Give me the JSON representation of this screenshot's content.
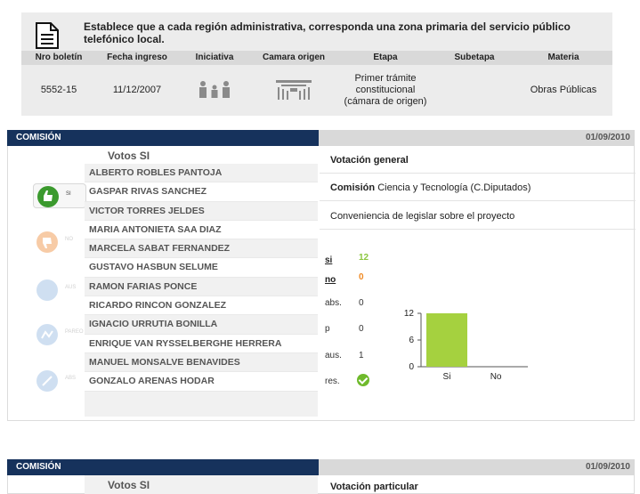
{
  "boletin": {
    "title": "Establece que a cada región administrativa, corresponda una zona primaria del servicio público telefónico local.",
    "columns": [
      "Nro boletín",
      "Fecha ingreso",
      "Iniciativa",
      "Camara origen",
      "Etapa",
      "Subetapa",
      "Materia"
    ],
    "row": {
      "nro": "5552-15",
      "fecha": "11/12/2007",
      "iniciativa_icon": "people-icon",
      "camara_icon": "chamber-icon",
      "etapa": "Primer trámite constitucional (cámara de origen)",
      "subetapa": "",
      "materia": "Obras Públicas"
    }
  },
  "comision1": {
    "header_label": "COMISIÓN",
    "date": "01/09/2010",
    "votes_heading": "Votos SI",
    "vote_buttons": [
      {
        "label": "SI",
        "icon": "thumbs-up-icon",
        "color": "#3b9a2e"
      },
      {
        "label": "NO",
        "icon": "thumbs-down-icon",
        "color": "#f2a15f"
      },
      {
        "label": "AUS",
        "icon": "absent-icon",
        "color": "#a9c6e6"
      },
      {
        "label": "PAREO",
        "icon": "pareo-icon",
        "color": "#a9c6e6"
      },
      {
        "label": "ABS",
        "icon": "abstention-icon",
        "color": "#a9c6e6"
      }
    ],
    "names": [
      "ALBERTO ROBLES PANTOJA",
      "GASPAR RIVAS SANCHEZ",
      "VICTOR TORRES JELDES",
      "MARIA ANTONIETA SAA DIAZ",
      "MARCELA SABAT FERNANDEZ",
      "GUSTAVO HASBUN SELUME",
      "RAMON FARIAS PONCE",
      "RICARDO RINCON GONZALEZ",
      "IGNACIO URRUTIA BONILLA",
      "ENRIQUE VAN RYSSELBERGHE HERRERA",
      "MANUEL MONSALVE BENAVIDES",
      "GONZALO ARENAS HODAR"
    ],
    "votacion_title": "Votación general",
    "comision_label": "Comisión",
    "comision_value": "Ciencia y Tecnología (C.Diputados)",
    "description": "Conveniencia de legislar sobre el proyecto",
    "stats": {
      "si_label": "si",
      "si_value": "12",
      "si_color": "#8cc63f",
      "no_label": "no",
      "no_value": "0",
      "no_color": "#f08a24",
      "abs_label": "abs.",
      "abs_value": "0",
      "p_label": "p",
      "p_value": "0",
      "aus_label": "aus.",
      "aus_value": "1",
      "res_label": "res.",
      "res_icon": "check-icon"
    },
    "chart_data": {
      "type": "bar",
      "categories": [
        "Si",
        "No"
      ],
      "values": [
        12,
        0
      ],
      "yticks": [
        0,
        6,
        12
      ],
      "ylim": [
        0,
        12
      ],
      "bar_color": "#a5d13f"
    }
  },
  "comision2": {
    "header_label": "COMISIÓN",
    "date": "01/09/2010",
    "votes_heading": "Votos SI",
    "votacion_title": "Votación particular"
  }
}
